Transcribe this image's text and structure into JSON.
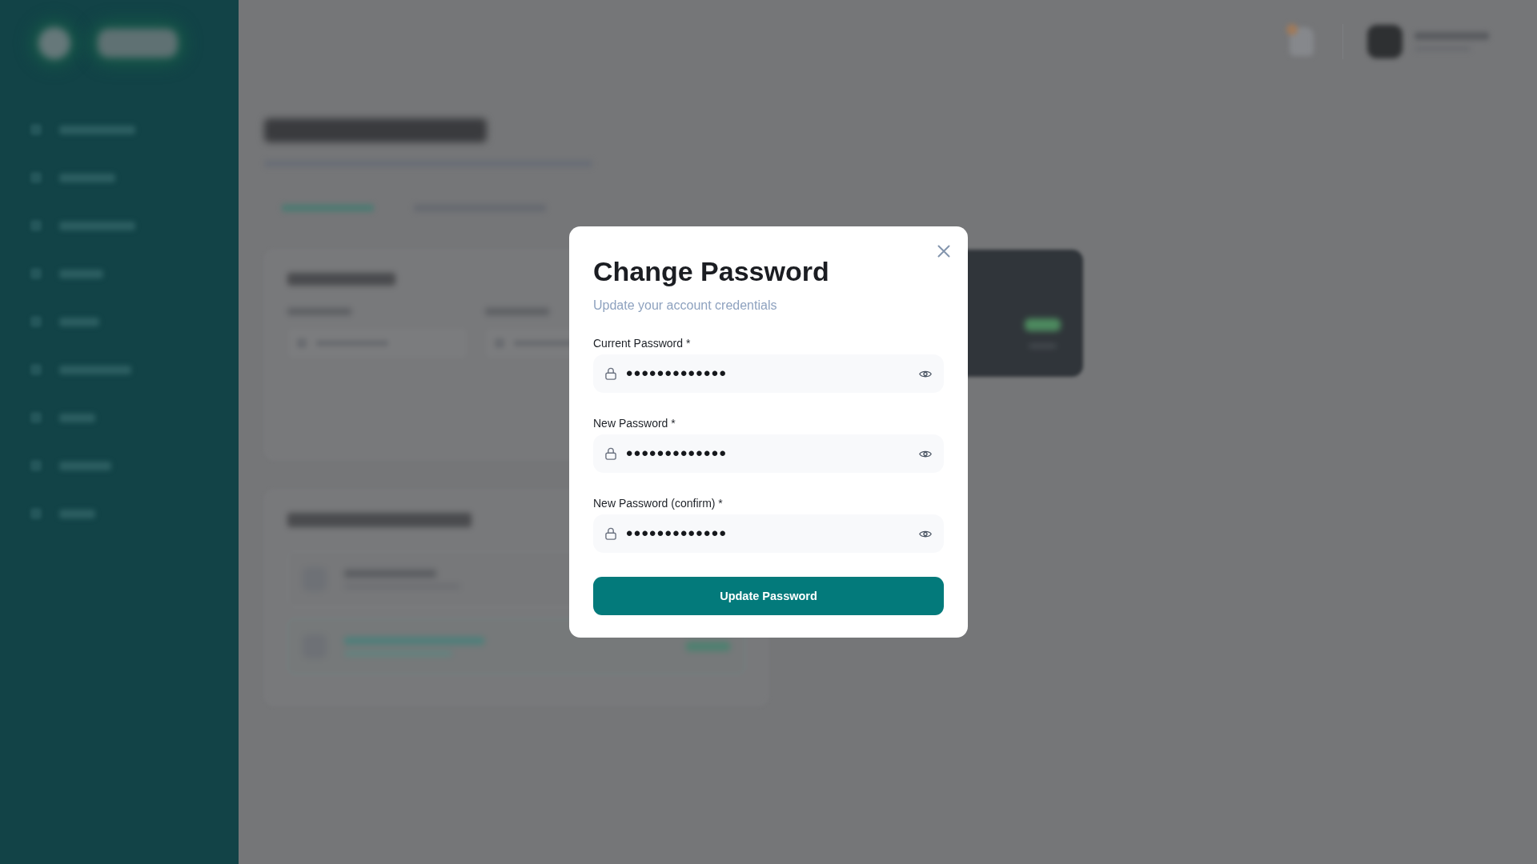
{
  "dialog": {
    "title": "Change Password",
    "subtitle": "Update your account credentials",
    "fields": [
      {
        "label": "Current Password *",
        "value": "•••••••••••••"
      },
      {
        "label": "New Password *",
        "value": "•••••••••••••"
      },
      {
        "label": "New Password (confirm) *",
        "value": "•••••••••••••"
      }
    ],
    "button": "Update Password"
  }
}
